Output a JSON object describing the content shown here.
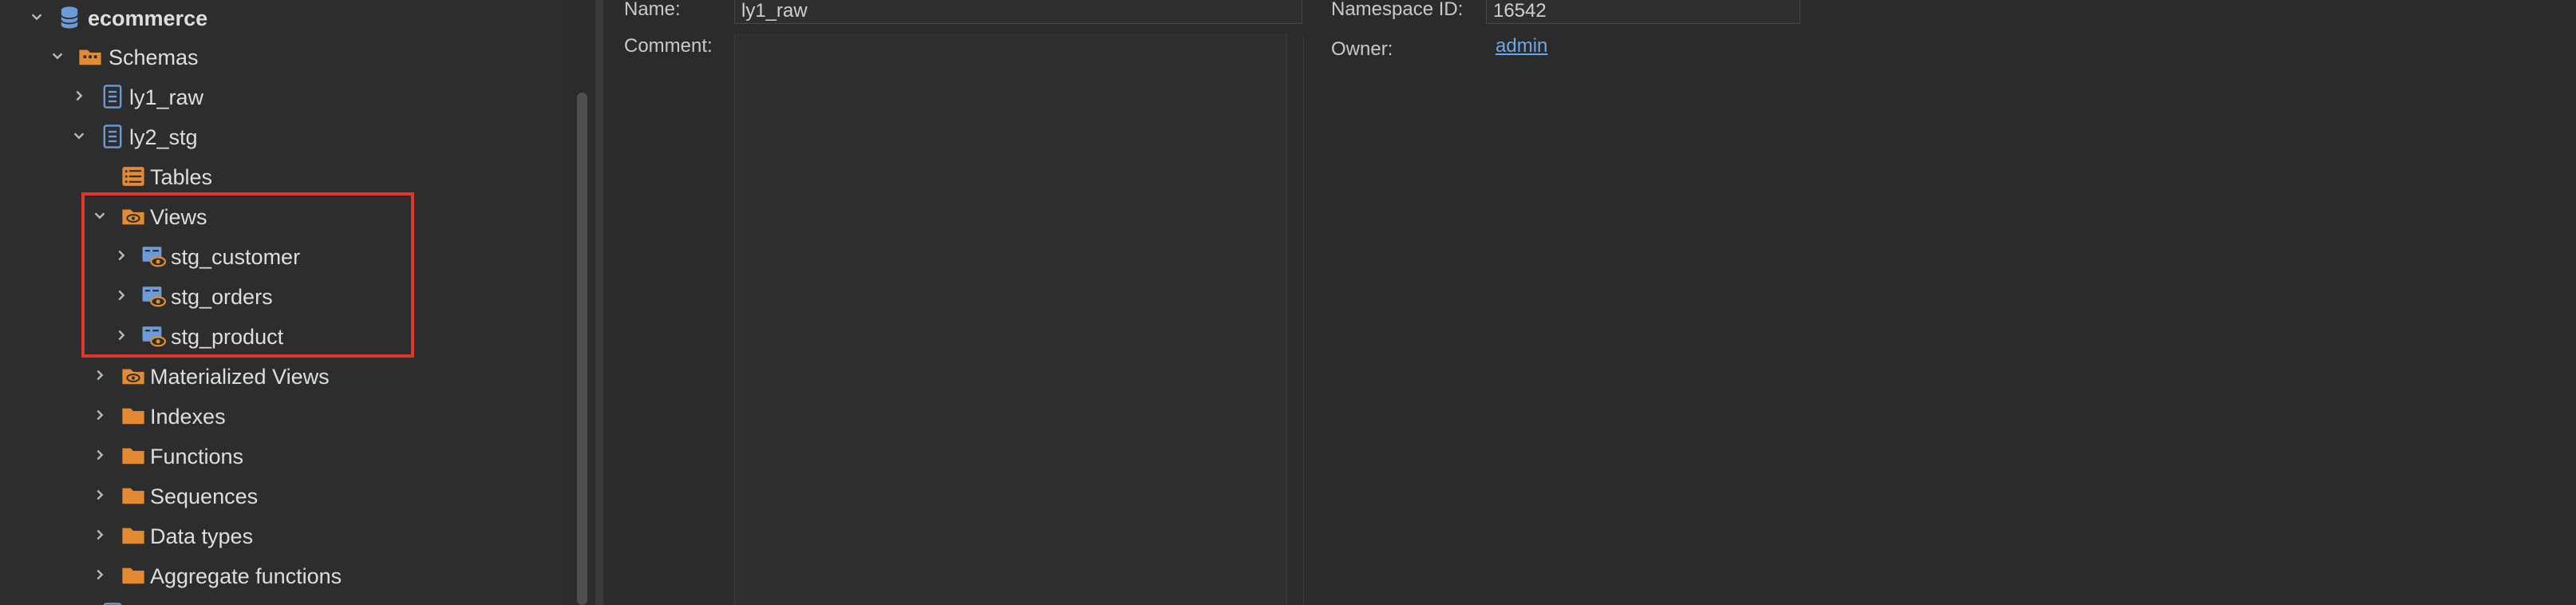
{
  "tree": {
    "database": "ecommerce",
    "schemas_label": "Schemas",
    "schema_raw": "ly1_raw",
    "schema_stg": "ly2_stg",
    "tables": "Tables",
    "views": "Views",
    "view_items": [
      "stg_customer",
      "stg_orders",
      "stg_product"
    ],
    "materialized_views": "Materialized Views",
    "indexes": "Indexes",
    "functions": "Functions",
    "sequences": "Sequences",
    "data_types": "Data types",
    "aggregate_functions": "Aggregate functions"
  },
  "details": {
    "name_label": "Name:",
    "name_value": "ly1_raw",
    "comment_label": "Comment:",
    "namespace_label": "Namespace ID:",
    "namespace_value": "16542",
    "owner_label": "Owner:",
    "owner_value": "admin"
  },
  "colors": {
    "highlight": "#e0372b",
    "folder": "#e48a33",
    "link": "#6ea6e8",
    "schema_icon": "#6b9bd8"
  },
  "icons": {
    "database": "database-icon",
    "schemas": "schemas-folder-icon",
    "schema": "schema-icon",
    "tables": "tables-icon",
    "views": "views-icon",
    "view": "view-icon",
    "folder": "folder-icon"
  }
}
